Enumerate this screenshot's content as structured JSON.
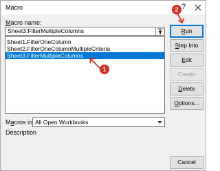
{
  "window": {
    "title": "Macro",
    "help_glyph": "?",
    "accent_color": "#0078d7"
  },
  "form": {
    "macro_name_label_pre": "",
    "macro_name_label_key": "M",
    "macro_name_label_post": "acro name:",
    "macro_name_value": "Sheet3.FilterMultipleColumns",
    "macros": [
      {
        "label": "Sheet1.FilterOneColumn",
        "selected": false
      },
      {
        "label": "Sheet2.FilterOneColumnMultipleCriteria",
        "selected": false
      },
      {
        "label": "Sheet3.FilterMultipleColumns",
        "selected": true
      }
    ],
    "macros_in_label_pre": "M",
    "macros_in_label_key": "a",
    "macros_in_label_post": "cros in:",
    "macros_in_value": "All Open Workbooks",
    "description_label": "Description"
  },
  "buttons": {
    "run": {
      "pre": "",
      "key": "R",
      "post": "un"
    },
    "step_into": {
      "pre": "",
      "key": "S",
      "post": "tep Into"
    },
    "edit": {
      "pre": "",
      "key": "E",
      "post": "dit"
    },
    "create": {
      "label": "Create"
    },
    "delete": {
      "pre": "",
      "key": "D",
      "post": "elete"
    },
    "options": {
      "pre": "",
      "key": "O",
      "post": "ptions..."
    },
    "cancel": {
      "label": "Cancel"
    }
  },
  "annotations": {
    "badge_1": "1",
    "badge_2": "2",
    "color": "#d62d20"
  }
}
